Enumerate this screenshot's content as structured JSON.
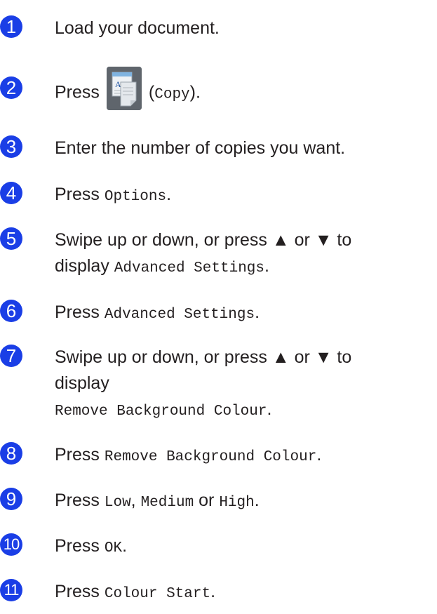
{
  "steps": [
    {
      "n": "1",
      "parts": [
        {
          "t": "Load your document.",
          "m": false
        }
      ]
    },
    {
      "n": "2",
      "parts": [
        {
          "t": "Press",
          "m": false
        },
        {
          "t": "(",
          "m": false
        },
        {
          "t": "Copy",
          "m": true
        },
        {
          "t": ").",
          "m": false
        }
      ],
      "icon": "copy-icon"
    },
    {
      "n": "3",
      "parts": [
        {
          "t": "Enter the number of copies you want.",
          "m": false
        }
      ]
    },
    {
      "n": "4",
      "parts": [
        {
          "t": "Press ",
          "m": false
        },
        {
          "t": "Options",
          "m": true
        },
        {
          "t": ".",
          "m": false
        }
      ]
    },
    {
      "n": "5",
      "line1": "Swipe up or down, or press ▲ or ▼ to",
      "line2a": "display ",
      "line2b": "Advanced Settings",
      "line2c": "."
    },
    {
      "n": "6",
      "parts": [
        {
          "t": "Press ",
          "m": false
        },
        {
          "t": "Advanced Settings",
          "m": true
        },
        {
          "t": ".",
          "m": false
        }
      ]
    },
    {
      "n": "7",
      "line1": "Swipe up or down, or press ▲ or ▼ to",
      "line2": "display",
      "line3": "Remove Background Colour",
      "line3end": "."
    },
    {
      "n": "8",
      "parts": [
        {
          "t": "Press ",
          "m": false
        },
        {
          "t": "Remove Background Colour",
          "m": true
        },
        {
          "t": ".",
          "m": false
        }
      ]
    },
    {
      "n": "9",
      "parts": [
        {
          "t": "Press ",
          "m": false
        },
        {
          "t": "Low",
          "m": true
        },
        {
          "t": ", ",
          "m": false
        },
        {
          "t": "Medium",
          "m": true
        },
        {
          "t": " or ",
          "m": false
        },
        {
          "t": "High",
          "m": true
        },
        {
          "t": ".",
          "m": false
        }
      ]
    },
    {
      "n": "10",
      "parts": [
        {
          "t": "Press ",
          "m": false
        },
        {
          "t": "OK",
          "m": true
        },
        {
          "t": ".",
          "m": false
        }
      ]
    },
    {
      "n": "11",
      "parts": [
        {
          "t": "Press ",
          "m": false
        },
        {
          "t": "Colour Start",
          "m": true
        },
        {
          "t": ".",
          "m": false
        }
      ]
    }
  ],
  "colors": {
    "step_badge": "#1a3ee6",
    "text": "#231f20"
  }
}
